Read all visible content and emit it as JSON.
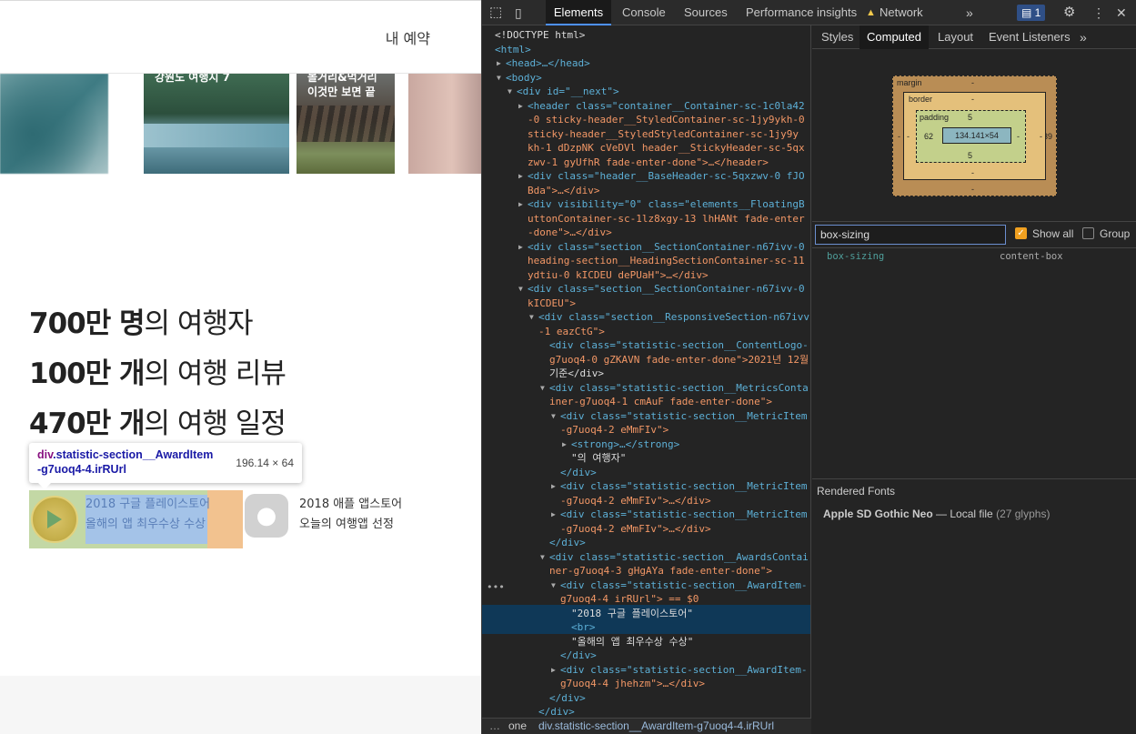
{
  "site": {
    "my_reservation": "내 예약",
    "cards": [
      {
        "caption_line1": "",
        "caption_line2": ""
      },
      {
        "caption_line1": "강원도 여행지 7",
        "caption_line2": ""
      },
      {
        "caption_line1": "볼거리&먹거리",
        "caption_line2": "이것만 보면 끝"
      },
      {
        "caption_line1": "",
        "caption_line2": ""
      }
    ],
    "metrics": [
      {
        "value": "700만 명",
        "suffix": "의 여행자"
      },
      {
        "value": "100만 개",
        "suffix": "의 여행 리뷰"
      },
      {
        "value": "470만 개",
        "suffix": "의 여행 일정"
      }
    ],
    "awards": [
      {
        "line1": "2018 구글 플레이스토어",
        "line2": "올해의 앱 최우수상 수상"
      },
      {
        "line1": "2018 애플 앱스토어",
        "line2": "오늘의 여행앱 선정"
      }
    ],
    "tooltip": {
      "tag": "div",
      "class_line1": ".statistic-section__AwardItem",
      "class_line2": "-g7uoq4-4.irRUrl",
      "size": "196.14 × 64"
    }
  },
  "devtools": {
    "tabs": [
      "Elements",
      "Console",
      "Sources",
      "Performance insights",
      "Network"
    ],
    "active_tab": "Elements",
    "issues_count": "1",
    "side_tabs": [
      "Styles",
      "Computed",
      "Layout",
      "Event Listeners"
    ],
    "active_side_tab": "Computed",
    "boxmodel": {
      "margin_label": "margin",
      "border_label": "border",
      "padding_label": "padding",
      "margin_top": "-",
      "margin_bottom": "-",
      "margin_left": "-",
      "margin_right": "39",
      "border_top": "-",
      "border_bottom": "-",
      "border_left": "-",
      "border_right": "-",
      "padding_top": "5",
      "padding_bottom": "5",
      "padding_left": "62",
      "padding_right": "-",
      "content": "134.141×54"
    },
    "filter_value": "box-sizing",
    "show_all_label": "Show all",
    "group_label": "Group",
    "show_all_checked": true,
    "group_checked": false,
    "prop_name": "box-sizing",
    "prop_value": "content-box",
    "rendered_fonts_title": "Rendered Fonts",
    "font_name": "Apple SD Gothic Neo",
    "font_source": "Local file",
    "font_glyphs": "(27 glyphs)",
    "breadcrumb_prev": "one",
    "breadcrumb_current": "div.statistic-section__AwardItem-g7uoq4-4.irRUrl",
    "dom_lines": [
      {
        "indent": 0,
        "arrow": "",
        "text": "<!DOCTYPE html>",
        "kind": "plain"
      },
      {
        "indent": 0,
        "arrow": "",
        "text": "<html>",
        "kind": "tag"
      },
      {
        "indent": 1,
        "arrow": "▶",
        "text": "<head>…</head>",
        "kind": "tag"
      },
      {
        "indent": 1,
        "arrow": "▼",
        "text": "<body>",
        "kind": "tag"
      },
      {
        "indent": 2,
        "arrow": "▼",
        "text": "<div id=\"__next\">",
        "kind": "tag"
      },
      {
        "indent": 3,
        "arrow": "▶",
        "text": "<header class=\"container__Container-sc-1c0la42",
        "kind": "tag"
      },
      {
        "indent": 3,
        "arrow": "",
        "text": "-0 sticky-header__StyledContainer-sc-1jy9ykh-0",
        "kind": "val"
      },
      {
        "indent": 3,
        "arrow": "",
        "text": "sticky-header__StyledStyledContainer-sc-1jy9y",
        "kind": "val"
      },
      {
        "indent": 3,
        "arrow": "",
        "text": "kh-1 dDzpNK cVeDVl header__StickyHeader-sc-5qx",
        "kind": "val"
      },
      {
        "indent": 3,
        "arrow": "",
        "text": "zwv-1 gyUfhR fade-enter-done\">…</header>",
        "kind": "val"
      },
      {
        "indent": 3,
        "arrow": "▶",
        "text": "<div class=\"header__BaseHeader-sc-5qxzwv-0 fJO",
        "kind": "tag"
      },
      {
        "indent": 3,
        "arrow": "",
        "text": "Bda\">…</div>",
        "kind": "val"
      },
      {
        "indent": 3,
        "arrow": "▶",
        "text": "<div visibility=\"0\" class=\"elements__FloatingB",
        "kind": "tag"
      },
      {
        "indent": 3,
        "arrow": "",
        "text": "uttonContainer-sc-1lz8xgy-13 lhHANt fade-enter",
        "kind": "val"
      },
      {
        "indent": 3,
        "arrow": "",
        "text": "-done\">…</div>",
        "kind": "val"
      },
      {
        "indent": 3,
        "arrow": "▶",
        "text": "<div class=\"section__SectionContainer-n67ivv-0",
        "kind": "tag"
      },
      {
        "indent": 3,
        "arrow": "",
        "text": "heading-section__HeadingSectionContainer-sc-11",
        "kind": "val"
      },
      {
        "indent": 3,
        "arrow": "",
        "text": "ydtiu-0 kICDEU dePUaH\">…</div>",
        "kind": "val"
      },
      {
        "indent": 3,
        "arrow": "▼",
        "text": "<div class=\"section__SectionContainer-n67ivv-0",
        "kind": "tag"
      },
      {
        "indent": 3,
        "arrow": "",
        "text": "kICDEU\">",
        "kind": "val"
      },
      {
        "indent": 4,
        "arrow": "▼",
        "text": "<div class=\"section__ResponsiveSection-n67ivv",
        "kind": "tag"
      },
      {
        "indent": 4,
        "arrow": "",
        "text": "-1 eazCtG\">",
        "kind": "val"
      },
      {
        "indent": 5,
        "arrow": "",
        "text": "<div class=\"statistic-section__ContentLogo-",
        "kind": "tag"
      },
      {
        "indent": 5,
        "arrow": "",
        "text": "g7uoq4-0 gZKAVN fade-enter-done\">2021년 12월",
        "kind": "val"
      },
      {
        "indent": 5,
        "arrow": "",
        "text": "기준</div>",
        "kind": "plain"
      },
      {
        "indent": 5,
        "arrow": "▼",
        "text": "<div class=\"statistic-section__MetricsConta",
        "kind": "tag"
      },
      {
        "indent": 5,
        "arrow": "",
        "text": "iner-g7uoq4-1 cmAuF fade-enter-done\">",
        "kind": "val"
      },
      {
        "indent": 6,
        "arrow": "▼",
        "text": "<div class=\"statistic-section__MetricItem",
        "kind": "tag"
      },
      {
        "indent": 6,
        "arrow": "",
        "text": "-g7uoq4-2 eMmFIv\">",
        "kind": "val"
      },
      {
        "indent": 7,
        "arrow": "▶",
        "text": "<strong>…</strong>",
        "kind": "tag"
      },
      {
        "indent": 7,
        "arrow": "",
        "text": "\"의 여행자\"",
        "kind": "plain"
      },
      {
        "indent": 6,
        "arrow": "",
        "text": "</div>",
        "kind": "tag"
      },
      {
        "indent": 6,
        "arrow": "▶",
        "text": "<div class=\"statistic-section__MetricItem",
        "kind": "tag"
      },
      {
        "indent": 6,
        "arrow": "",
        "text": "-g7uoq4-2 eMmFIv\">…</div>",
        "kind": "val"
      },
      {
        "indent": 6,
        "arrow": "▶",
        "text": "<div class=\"statistic-section__MetricItem",
        "kind": "tag"
      },
      {
        "indent": 6,
        "arrow": "",
        "text": "-g7uoq4-2 eMmFIv\">…</div>",
        "kind": "val"
      },
      {
        "indent": 5,
        "arrow": "",
        "text": "</div>",
        "kind": "tag"
      },
      {
        "indent": 5,
        "arrow": "▼",
        "text": "<div class=\"statistic-section__AwardsContai",
        "kind": "tag"
      },
      {
        "indent": 5,
        "arrow": "",
        "text": "ner-g7uoq4-3 gHgAYa fade-enter-done\">",
        "kind": "val"
      },
      {
        "indent": 6,
        "arrow": "▼",
        "text": "<div class=\"statistic-section__AwardItem-",
        "kind": "tag"
      },
      {
        "indent": 6,
        "arrow": "",
        "text": "g7uoq4-4 irRUrl\"> == $0",
        "kind": "val"
      },
      {
        "indent": 7,
        "arrow": "",
        "text": "\"2018 구글 플레이스토어\"",
        "kind": "plain"
      },
      {
        "indent": 7,
        "arrow": "",
        "text": "<br>",
        "kind": "tag"
      },
      {
        "indent": 7,
        "arrow": "",
        "text": "\"올해의 앱 최우수상 수상\"",
        "kind": "plain"
      },
      {
        "indent": 6,
        "arrow": "",
        "text": "</div>",
        "kind": "tag"
      },
      {
        "indent": 6,
        "arrow": "▶",
        "text": "<div class=\"statistic-section__AwardItem-",
        "kind": "tag"
      },
      {
        "indent": 6,
        "arrow": "",
        "text": "g7uoq4-4 jhehzm\">…</div>",
        "kind": "val"
      },
      {
        "indent": 5,
        "arrow": "",
        "text": "</div>",
        "kind": "tag"
      },
      {
        "indent": 4,
        "arrow": "",
        "text": "</div>",
        "kind": "tag"
      }
    ]
  },
  "colors": {
    "devtools_bg": "#242424",
    "selection": "#0f3857",
    "accent": "#4e91ff",
    "tag": "#5db0d7",
    "attr_value": "#f29766"
  }
}
